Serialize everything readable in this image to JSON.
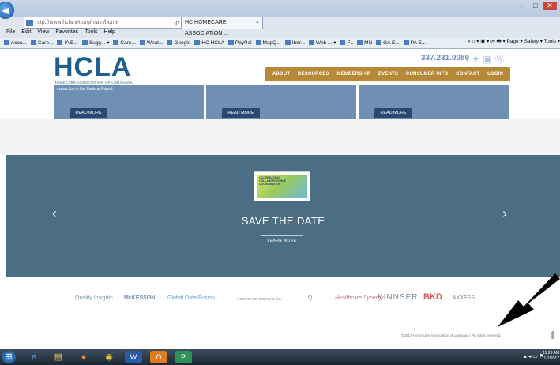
{
  "browser": {
    "url": "http://www.hclanet.org/main/home",
    "tab_title": "HC HOMECARE ASSOCIATION ...",
    "go_symbol": "ρ ▾ C",
    "menu": [
      "File",
      "Edit",
      "View",
      "Favorites",
      "Tools",
      "Help"
    ],
    "favorites": [
      "Acco...",
      "Care...",
      "IA E...",
      "Sugg... ▾",
      "Care...",
      "Weat...",
      "Google",
      "HC HCLA",
      "PayPal",
      "MapQ...",
      "Iber...",
      "Web ... ▾",
      "FL",
      "MN",
      "GA E...",
      "PA E..."
    ],
    "favbar_right": "» ⌂ ▾ ▣ ▾ ✉ 🖶 ▾ Page ▾ Safety ▾ Tools ▾"
  },
  "site": {
    "logo_text": "HCLA",
    "logo_tagline": "HOMECARE ASSOCIATION OF LOUISIANA",
    "phone": "337.231.0080",
    "nav": [
      "ABOUT",
      "RESOURCES",
      "MEMBERSHIP",
      "EVENTS",
      "CONSUMER INFO",
      "CONTACT",
      "LOGIN"
    ],
    "cards": [
      {
        "text": "inspection in the Federal Regist...",
        "button": "READ MORE"
      },
      {
        "text": "",
        "button": "READ MORE"
      },
      {
        "text": "",
        "button": "READ MORE"
      }
    ],
    "hero": {
      "badge_text": "COOPERATION, COLLABORATION & COORDINATION",
      "title": "SAVE THE DATE",
      "button": "LEARN MORE",
      "prev": "‹",
      "next": "›"
    },
    "sponsors": [
      "Quality Insights",
      "McKESSON",
      "Global Data Fusion",
      "HOMECARE GROUP & CO.",
      "Q",
      "Healthcare Synergy",
      "KINNSER",
      "BKD",
      "AXXESS"
    ],
    "footer": "©2017 HomeCare Association of Louisiana | All rights reserved."
  },
  "taskbar": {
    "clock_time": "11:25 AM",
    "clock_date": "11/7/2017"
  },
  "colors": {
    "nav_bar": "#b78835",
    "hero": "#4b6e84",
    "cards": "#6f8fb5",
    "logo": "#1f5f8f"
  }
}
